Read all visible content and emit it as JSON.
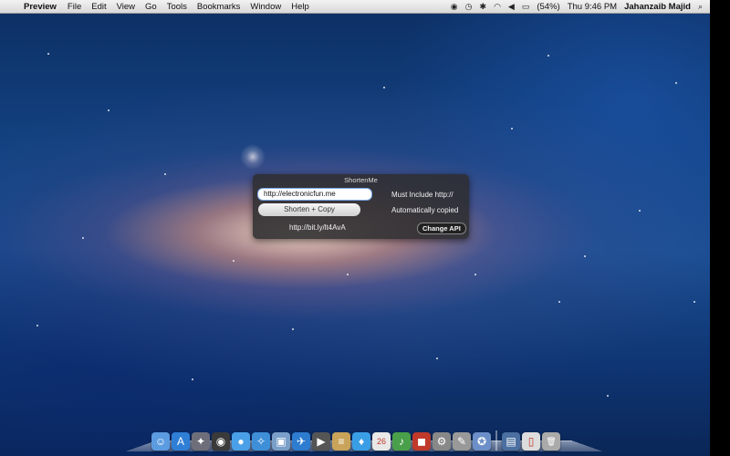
{
  "menubar": {
    "app_name": "Preview",
    "items": [
      "File",
      "Edit",
      "View",
      "Go",
      "Tools",
      "Bookmarks",
      "Window",
      "Help"
    ],
    "battery": "(54%)",
    "clock": "Thu 9:46 PM",
    "user": "Jahanzaib Majid"
  },
  "hud": {
    "title": "ShortenMe",
    "url_value": "http://electronicfun.me",
    "shorten_button": "Shorten + Copy",
    "hint_url": "Must Include http://",
    "hint_copied": "Automatically copied",
    "short_url": "http://bit.ly/lt4AvA",
    "change_api_button": "Change API"
  },
  "dock": {
    "items": [
      {
        "icon": "finder-icon",
        "color": "#5b9be0",
        "glyph": "☺"
      },
      {
        "icon": "app-store-icon",
        "color": "#2f7fd6",
        "glyph": "A"
      },
      {
        "icon": "launchpad-icon",
        "color": "#6e6e7a",
        "glyph": "✦"
      },
      {
        "icon": "dashboard-icon",
        "color": "#3a3a3a",
        "glyph": "◉"
      },
      {
        "icon": "ichat-icon",
        "color": "#4aa0e8",
        "glyph": "●"
      },
      {
        "icon": "safari-icon",
        "color": "#3e8fd8",
        "glyph": "✧"
      },
      {
        "icon": "preview-icon",
        "color": "#7a9fc9",
        "glyph": "▣"
      },
      {
        "icon": "mail-icon",
        "color": "#2d7cd0",
        "glyph": "✈"
      },
      {
        "icon": "facetime-icon",
        "color": "#555",
        "glyph": "▶"
      },
      {
        "icon": "notes-icon",
        "color": "#c9a35a",
        "glyph": "≡"
      },
      {
        "icon": "twitter-icon",
        "color": "#3a9ee6",
        "glyph": "♦"
      },
      {
        "icon": "calendar-icon",
        "color": "#e8e8e8",
        "glyph": "26"
      },
      {
        "icon": "itunes-icon",
        "color": "#4aa04a",
        "glyph": "♪"
      },
      {
        "icon": "photo-booth-icon",
        "color": "#c0392b",
        "glyph": "◼"
      },
      {
        "icon": "system-preferences-icon",
        "color": "#888",
        "glyph": "⚙"
      },
      {
        "icon": "utilities-icon",
        "color": "#999",
        "glyph": "✎"
      },
      {
        "icon": "image-capture-icon",
        "color": "#6c8fc9",
        "glyph": "✪"
      },
      {
        "icon": "downloads-stack-icon",
        "color": "#4a6fa0",
        "glyph": "▤"
      },
      {
        "icon": "document-stack-icon",
        "color": "#ddd",
        "glyph": "▯"
      },
      {
        "icon": "trash-icon",
        "color": "#aaa",
        "glyph": "🗑"
      }
    ]
  }
}
